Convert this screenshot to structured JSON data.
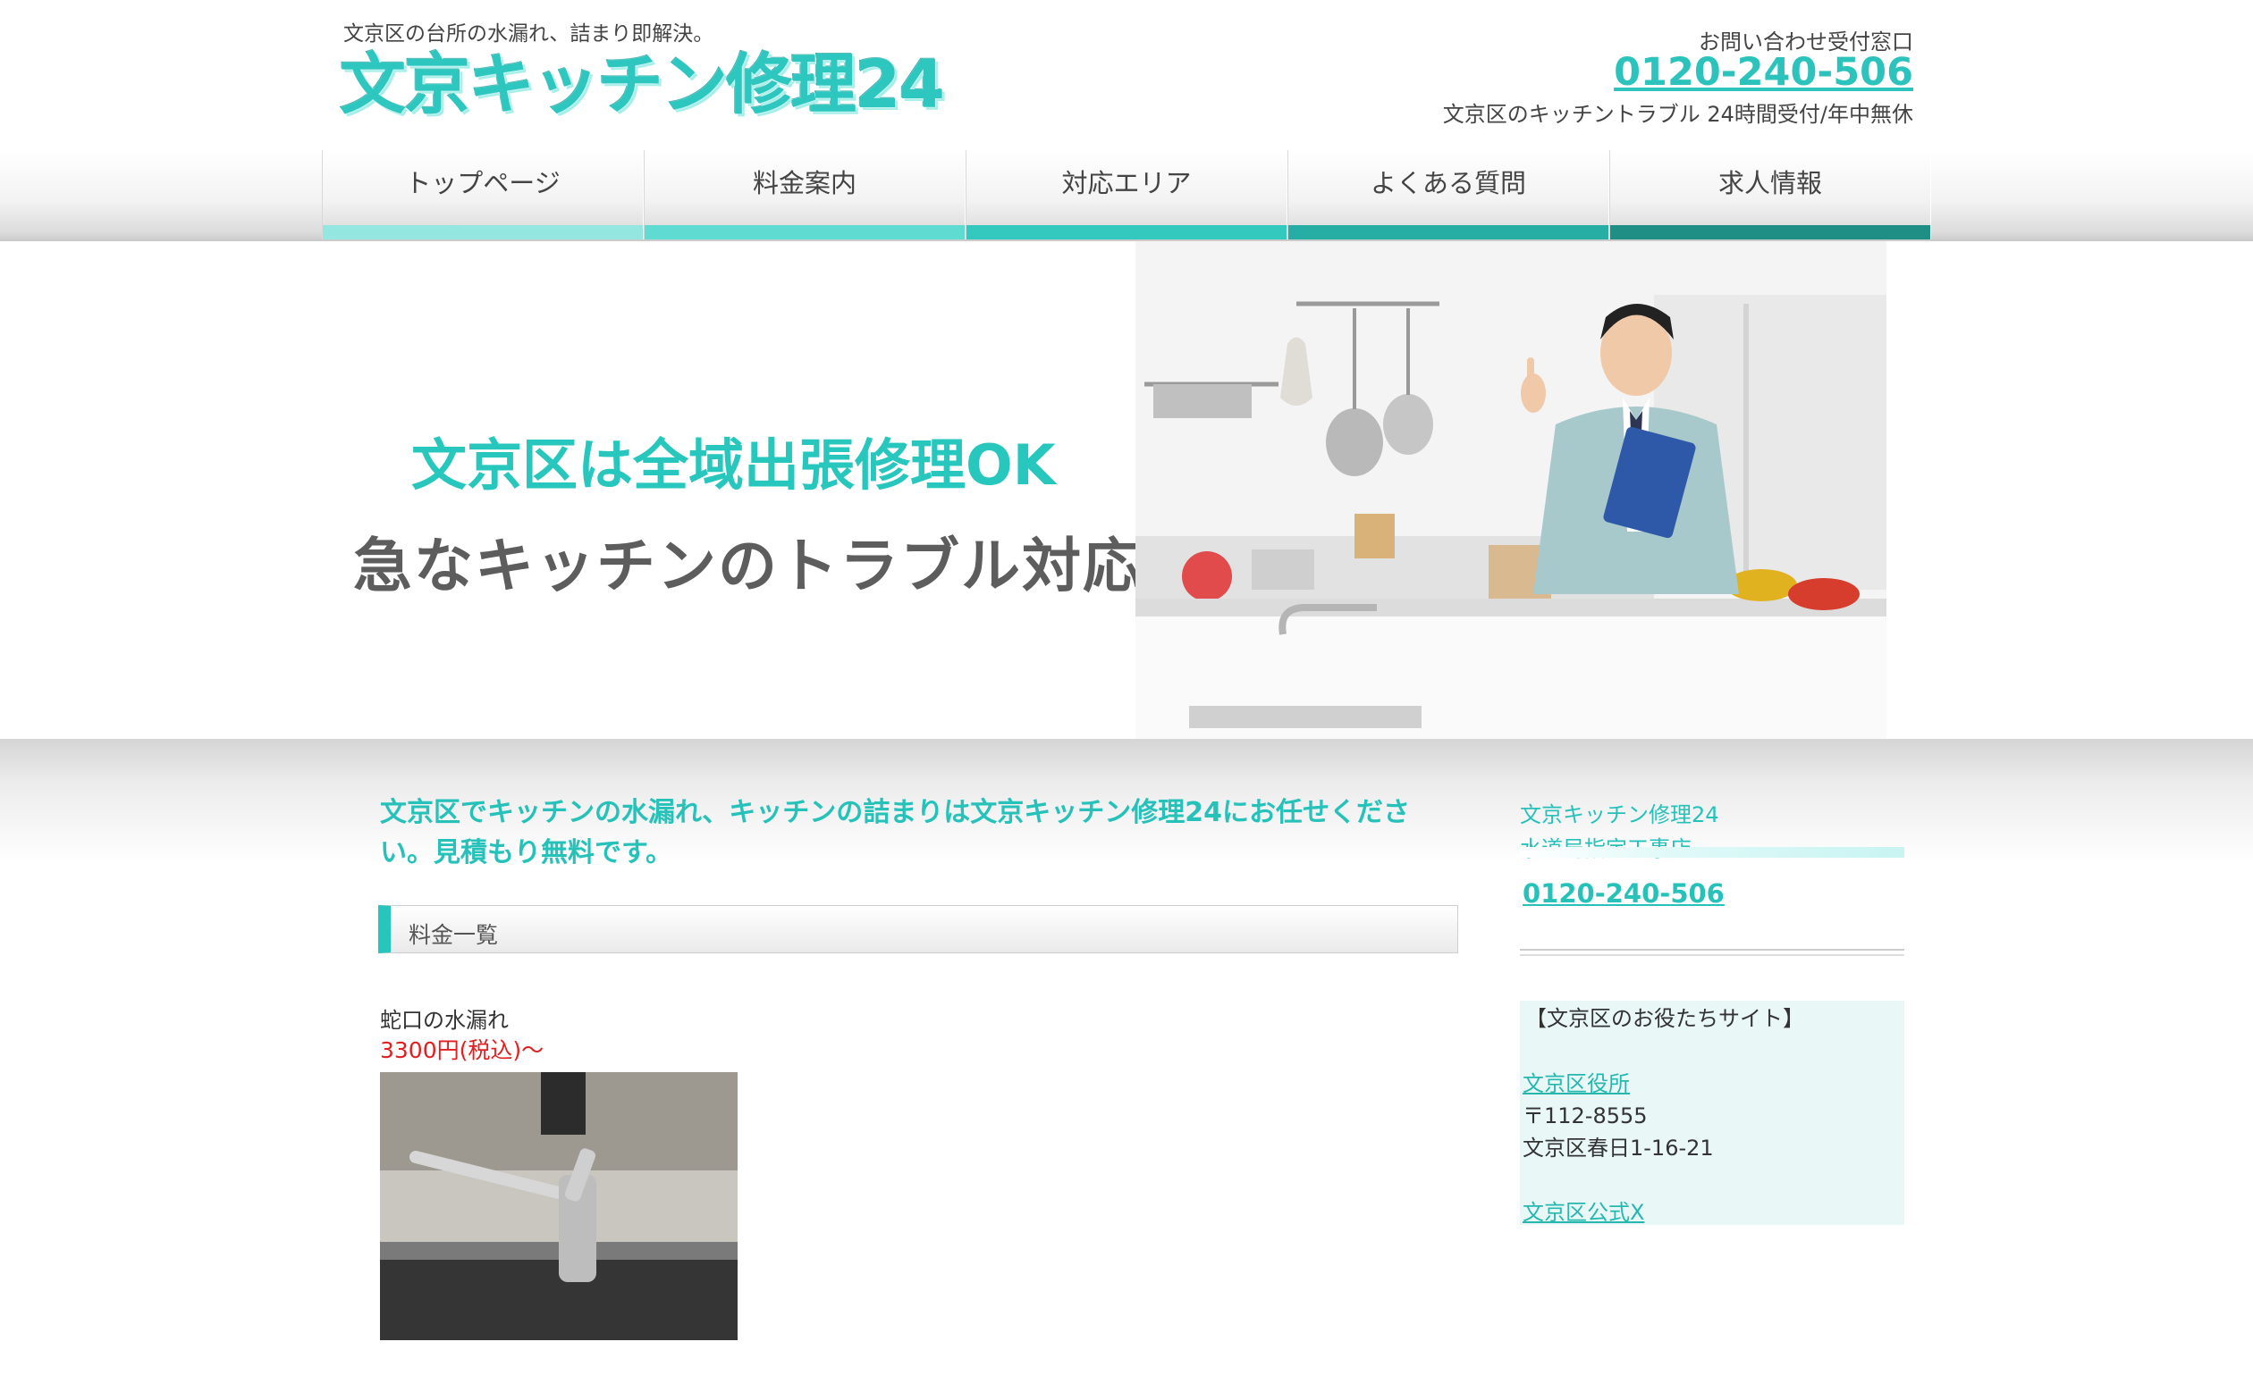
{
  "header": {
    "tagline": "文京区の台所の水漏れ、詰まり即解決。",
    "logo_text": "文京キッチン修理24",
    "contact_label": "お問い合わせ受付窓口",
    "phone": "0120-240-506",
    "hours": "文京区のキッチントラブル 24時間受付/年中無休"
  },
  "nav": {
    "items": [
      {
        "label": "トップページ",
        "color": "#94e6e0"
      },
      {
        "label": "料金案内",
        "color": "#60dbd2"
      },
      {
        "label": "対応エリア",
        "color": "#33c9bf"
      },
      {
        "label": "よくある質問",
        "color": "#26aea4"
      },
      {
        "label": "求人情報",
        "color": "#1f8e84"
      }
    ]
  },
  "hero": {
    "line1": "文京区は全域出張修理OK",
    "line2": "急なキッチンのトラブル対応"
  },
  "main": {
    "intro": "文京区でキッチンの水漏れ、キッチンの詰まりは文京キッチン修理24にお任せください。見積もり無料です。",
    "section_title": "料金一覧",
    "service_name": "蛇口の水漏れ",
    "service_price": "3300円(税込)〜"
  },
  "sidebar": {
    "title_line1": "文京キッチン修理24",
    "title_line2": "水道局指定工事店",
    "phone": "0120-240-506",
    "box_title": "【文京区のお役たちサイト】",
    "link1": "文京区役所",
    "postal": "〒112-8555",
    "address": "文京区春日1-16-21",
    "link2": "文京区公式X"
  },
  "colors": {
    "accent": "#26c2ba",
    "price": "#e02020"
  }
}
